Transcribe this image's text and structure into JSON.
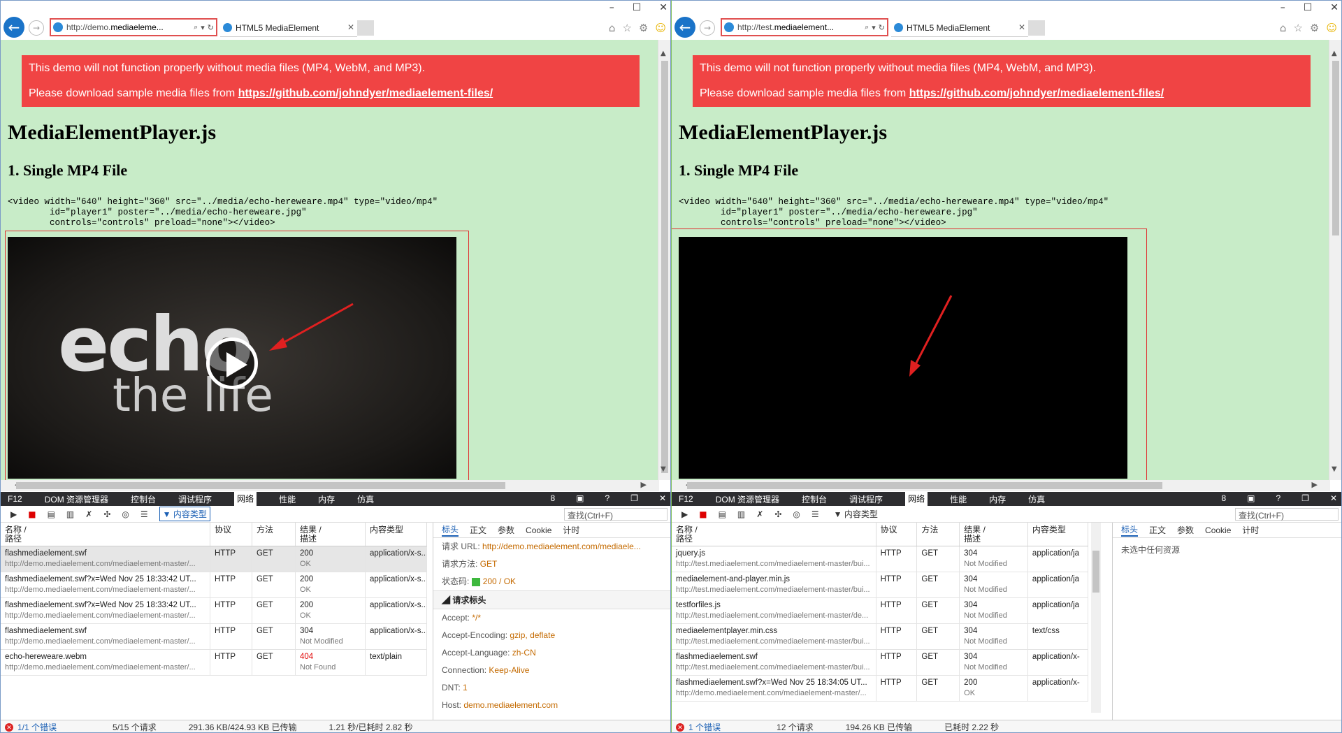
{
  "common": {
    "tab_title": "HTML5 MediaElement",
    "warning_line1": "This demo will not function properly without media files (MP4, WebM, and MP3).",
    "warning_line2_prefix": "Please download sample media files from ",
    "warning_link": "https://github.com/johndyer/mediaelement-files/",
    "h1": "MediaElementPlayer.js",
    "h2": "1. Single MP4 File",
    "code": "<video width=\"640\" height=\"360\" src=\"../media/echo-hereweare.mp4\" type=\"video/mp4\"\n\tid=\"player1\" poster=\"../media/echo-hereweare.jpg\"\n\tcontrols=\"controls\" preload=\"none\"></video>",
    "devtools_tabs": [
      "F12",
      "DOM 资源管理器",
      "控制台",
      "调试程序",
      "网络",
      "性能",
      "内存",
      "仿真"
    ],
    "devtools_count": "8",
    "filter_label": "内容类型",
    "find_placeholder": "查找(Ctrl+F)",
    "col_name": "名称 /",
    "col_path": "路径",
    "col_protocol": "协议",
    "col_method": "方法",
    "col_result": "结果 /",
    "col_desc": "描述",
    "col_type": "内容类型",
    "pane_tabs": [
      "标头",
      "正文",
      "参数",
      "Cookie",
      "计时"
    ]
  },
  "left": {
    "url_prefix": "http://demo.",
    "url_host": "mediaeleme...",
    "video_text1": "echo",
    "video_text2": "the life",
    "rows": [
      {
        "name": "flashmediaelement.swf",
        "path": "http://demo.mediaelement.com/mediaelement-master/...",
        "proto": "HTTP",
        "method": "GET",
        "code": "200",
        "desc": "OK",
        "type": "application/x-s..."
      },
      {
        "name": "flashmediaelement.swf?x=Wed Nov 25 18:33:42 UT...",
        "path": "http://demo.mediaelement.com/mediaelement-master/...",
        "proto": "HTTP",
        "method": "GET",
        "code": "200",
        "desc": "OK",
        "type": "application/x-s..."
      },
      {
        "name": "flashmediaelement.swf?x=Wed Nov 25 18:33:42 UT...",
        "path": "http://demo.mediaelement.com/mediaelement-master/...",
        "proto": "HTTP",
        "method": "GET",
        "code": "200",
        "desc": "OK",
        "type": "application/x-s..."
      },
      {
        "name": "flashmediaelement.swf",
        "path": "http://demo.mediaelement.com/mediaelement-master/...",
        "proto": "HTTP",
        "method": "GET",
        "code": "304",
        "desc": "Not Modified",
        "type": "application/x-s..."
      },
      {
        "name": "echo-hereweare.webm",
        "path": "http://demo.mediaelement.com/mediaelement-master/...",
        "proto": "HTTP",
        "method": "GET",
        "code": "404",
        "desc": "Not Found",
        "type": "text/plain"
      }
    ],
    "req_url_label": "请求 URL:",
    "req_url": "http://demo.mediaelement.com/mediaele...",
    "req_method_label": "请求方法:",
    "req_method": "GET",
    "status_label": "状态码:",
    "status_val": "200 / OK",
    "req_headers": "请求标头",
    "accept_label": "Accept:",
    "accept": "*/*",
    "enc_label": "Accept-Encoding:",
    "enc": "gzip, deflate",
    "lang_label": "Accept-Language:",
    "lang": "zh-CN",
    "conn_label": "Connection:",
    "conn": "Keep-Alive",
    "dnt_label": "DNT:",
    "dnt": "1",
    "host_label": "Host:",
    "host": "demo.mediaelement.com",
    "st_errors": "1/1 个错误",
    "st_requests": "5/15 个请求",
    "st_transfer": "291.36 KB/424.93 KB 已传输",
    "st_time": "1.21 秒/已耗时 2.82 秒"
  },
  "right": {
    "url_prefix": "http://test.",
    "url_host": "mediaelement...",
    "rows": [
      {
        "name": "jquery.js",
        "path": "http://test.mediaelement.com/mediaelement-master/bui...",
        "proto": "HTTP",
        "method": "GET",
        "code": "304",
        "desc": "Not Modified",
        "type": "application/ja"
      },
      {
        "name": "mediaelement-and-player.min.js",
        "path": "http://test.mediaelement.com/mediaelement-master/bui...",
        "proto": "HTTP",
        "method": "GET",
        "code": "304",
        "desc": "Not Modified",
        "type": "application/ja"
      },
      {
        "name": "testforfiles.js",
        "path": "http://test.mediaelement.com/mediaelement-master/de...",
        "proto": "HTTP",
        "method": "GET",
        "code": "304",
        "desc": "Not Modified",
        "type": "application/ja"
      },
      {
        "name": "mediaelementplayer.min.css",
        "path": "http://test.mediaelement.com/mediaelement-master/bui...",
        "proto": "HTTP",
        "method": "GET",
        "code": "304",
        "desc": "Not Modified",
        "type": "text/css"
      },
      {
        "name": "flashmediaelement.swf",
        "path": "http://test.mediaelement.com/mediaelement-master/bui...",
        "proto": "HTTP",
        "method": "GET",
        "code": "304",
        "desc": "Not Modified",
        "type": "application/x-"
      },
      {
        "name": "flashmediaelement.swf?x=Wed Nov 25 18:34:05 UT...",
        "path": "http://demo.mediaelement.com/mediaelement-master/...",
        "proto": "HTTP",
        "method": "GET",
        "code": "200",
        "desc": "OK",
        "type": "application/x-"
      }
    ],
    "no_selection": "未选中任何资源",
    "st_errors": "1 个错误",
    "st_requests": "12 个请求",
    "st_transfer": "194.26 KB 已传输",
    "st_time": "已耗时 2.22 秒"
  }
}
